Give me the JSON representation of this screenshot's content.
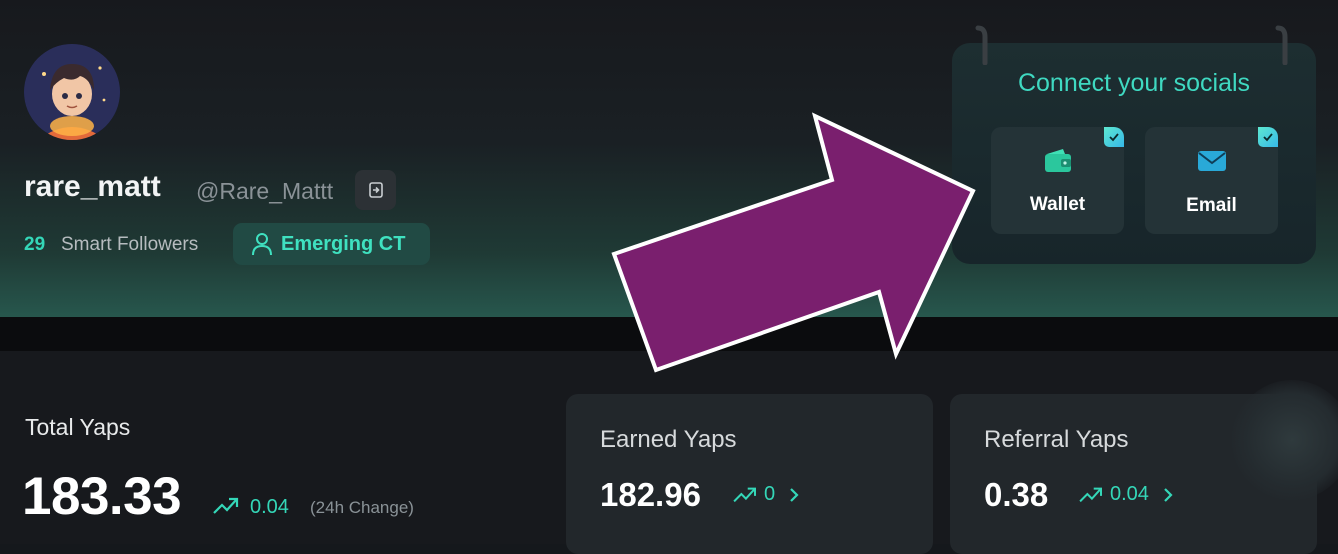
{
  "profile": {
    "username": "rare_matt",
    "handle": "@Rare_Mattt",
    "smart_followers_count": "29",
    "smart_followers_label": "Smart Followers",
    "badge_label": "Emerging CT"
  },
  "socials": {
    "title": "Connect your socials",
    "items": [
      {
        "label": "Wallet",
        "icon": "wallet-icon",
        "connected": true
      },
      {
        "label": "Email",
        "icon": "email-icon",
        "connected": true
      }
    ]
  },
  "stats": {
    "total": {
      "label": "Total Yaps",
      "value": "183.33",
      "change": "0.04",
      "change_note": "(24h Change)"
    },
    "earned": {
      "label": "Earned Yaps",
      "value": "182.96",
      "change": "0"
    },
    "referral": {
      "label": "Referral Yaps",
      "value": "0.38",
      "change": "0.04"
    }
  },
  "colors": {
    "accent": "#34d7b8",
    "annotation_arrow": "#7a1f6e",
    "background": "#15181c"
  }
}
